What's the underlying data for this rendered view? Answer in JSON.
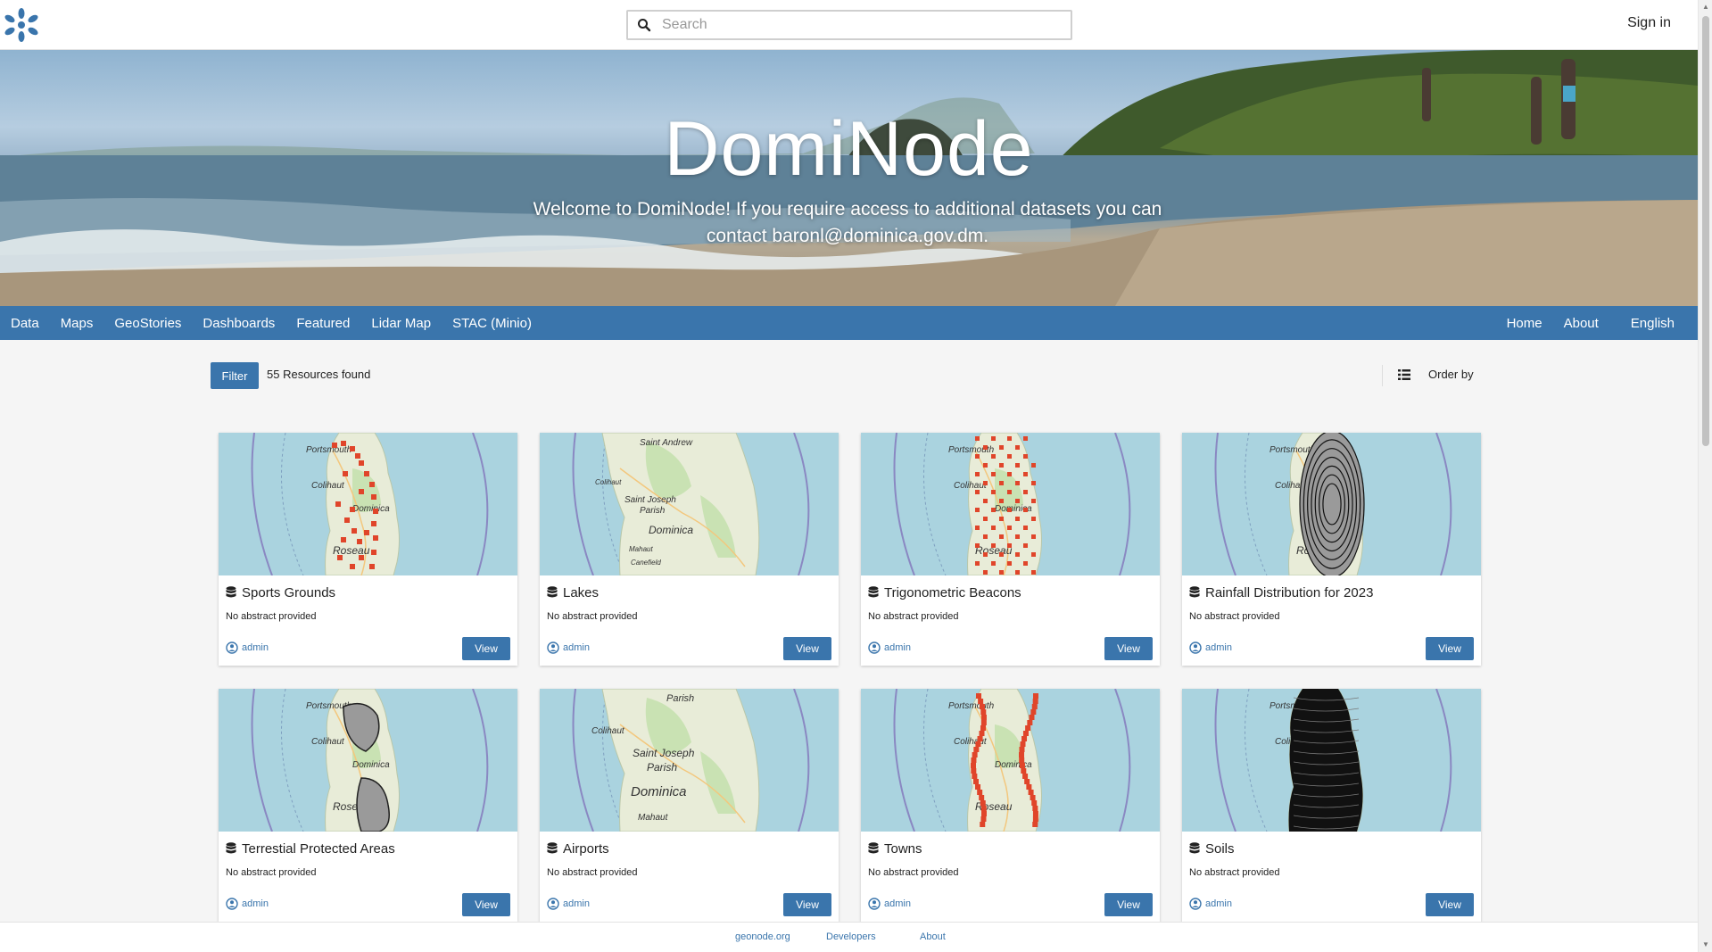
{
  "header": {
    "search_placeholder": "Search",
    "sign_in_label": "Sign in"
  },
  "hero": {
    "title": "DomiNode",
    "subtitle": "Welcome to DomiNode! If you require access to additional datasets you can contact baronl@dominica.gov.dm."
  },
  "nav": {
    "left": [
      "Data",
      "Maps",
      "GeoStories",
      "Dashboards",
      "Featured",
      "Lidar Map",
      "STAC (Minio)"
    ],
    "right": [
      "Home",
      "About",
      "English"
    ]
  },
  "toolbar": {
    "filter_label": "Filter",
    "results_label": "55 Resources found",
    "order_by_label": "Order by"
  },
  "resources": [
    {
      "title": "Sports Grounds",
      "abstract": "No abstract provided",
      "owner": "admin",
      "action": "View",
      "overlay": "red-dots-west"
    },
    {
      "title": "Lakes",
      "abstract": "No abstract provided",
      "owner": "admin",
      "action": "View",
      "overlay": "none"
    },
    {
      "title": "Trigonometric Beacons",
      "abstract": "No abstract provided",
      "owner": "admin",
      "action": "View",
      "overlay": "red-grid"
    },
    {
      "title": "Rainfall Distribution for 2023",
      "abstract": "No abstract provided",
      "owner": "admin",
      "action": "View",
      "overlay": "contours"
    },
    {
      "title": "Terrestial Protected Areas",
      "abstract": "No abstract provided",
      "owner": "admin",
      "action": "View",
      "overlay": "grey-polygons"
    },
    {
      "title": "Airports",
      "abstract": "No abstract provided",
      "owner": "admin",
      "action": "View",
      "overlay": "none"
    },
    {
      "title": "Towns",
      "abstract": "No abstract provided",
      "owner": "admin",
      "action": "View",
      "overlay": "red-coast"
    },
    {
      "title": "Soils",
      "abstract": "No abstract provided",
      "owner": "admin",
      "action": "View",
      "overlay": "black-mesh"
    }
  ],
  "map_labels": {
    "portsmouth": "Portsmouth",
    "colihaut": "Colihaut",
    "dominica": "Dominica",
    "roseau": "Roseau",
    "saint_joseph": "Saint Joseph",
    "parish": "Parish",
    "saint_andrew": "Saint Andrew",
    "mahaut": "Mahaut",
    "canefield": "Canefield"
  },
  "footer": {
    "links": [
      "geonode.org",
      "Developers",
      "About"
    ]
  },
  "colors": {
    "brand": "#3a75ac",
    "sea": "#aad3df",
    "land": "#e8ecd8",
    "marker_red": "#e0452a"
  }
}
